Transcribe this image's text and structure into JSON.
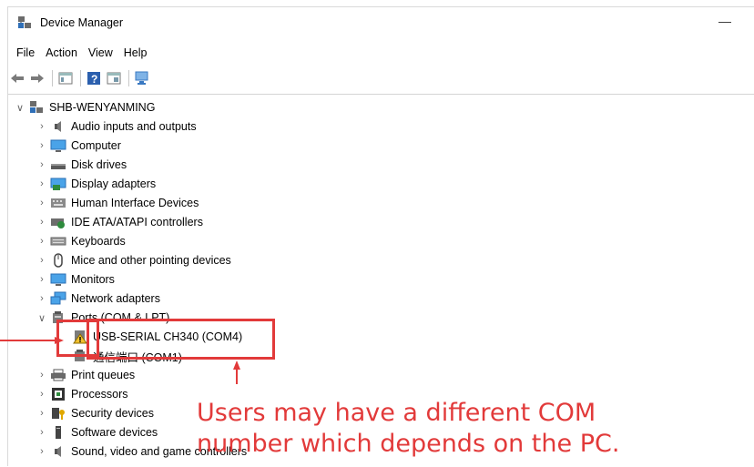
{
  "window": {
    "title": "Device Manager",
    "minimize_glyph": "—"
  },
  "menu": [
    "File",
    "Action",
    "View",
    "Help"
  ],
  "toolbar": [
    "back-icon",
    "forward-icon",
    "properties-icon",
    "help-icon",
    "view-icon",
    "scan-hardware-icon"
  ],
  "tree": {
    "root": "SHB-WENYANMING",
    "items": [
      {
        "label": "Audio inputs and outputs",
        "icon": "speaker-icon"
      },
      {
        "label": "Computer",
        "icon": "monitor-icon"
      },
      {
        "label": "Disk drives",
        "icon": "disk-icon"
      },
      {
        "label": "Display adapters",
        "icon": "display-adapter-icon"
      },
      {
        "label": "Human Interface Devices",
        "icon": "hid-icon"
      },
      {
        "label": "IDE ATA/ATAPI controllers",
        "icon": "ide-icon"
      },
      {
        "label": "Keyboards",
        "icon": "keyboard-icon"
      },
      {
        "label": "Mice and other pointing devices",
        "icon": "mouse-icon"
      },
      {
        "label": "Monitors",
        "icon": "monitor-icon"
      },
      {
        "label": "Network adapters",
        "icon": "network-icon"
      },
      {
        "label": "Ports (COM & LPT)",
        "icon": "port-icon",
        "expanded": true,
        "children": [
          {
            "label": "USB-SERIAL CH340 (COM4)",
            "icon": "warning-port-icon"
          },
          {
            "label": "通信端口 (COM1)",
            "icon": "port-icon"
          }
        ]
      },
      {
        "label": "Print queues",
        "icon": "printer-icon"
      },
      {
        "label": "Processors",
        "icon": "processor-icon"
      },
      {
        "label": "Security devices",
        "icon": "security-icon"
      },
      {
        "label": "Software devices",
        "icon": "software-icon"
      },
      {
        "label": "Sound, video and game controllers",
        "icon": "speaker-icon"
      }
    ]
  },
  "annotation": {
    "line1": "Users may have a different COM",
    "line2": "number which depends on the PC.",
    "color": "#e23a3a"
  }
}
